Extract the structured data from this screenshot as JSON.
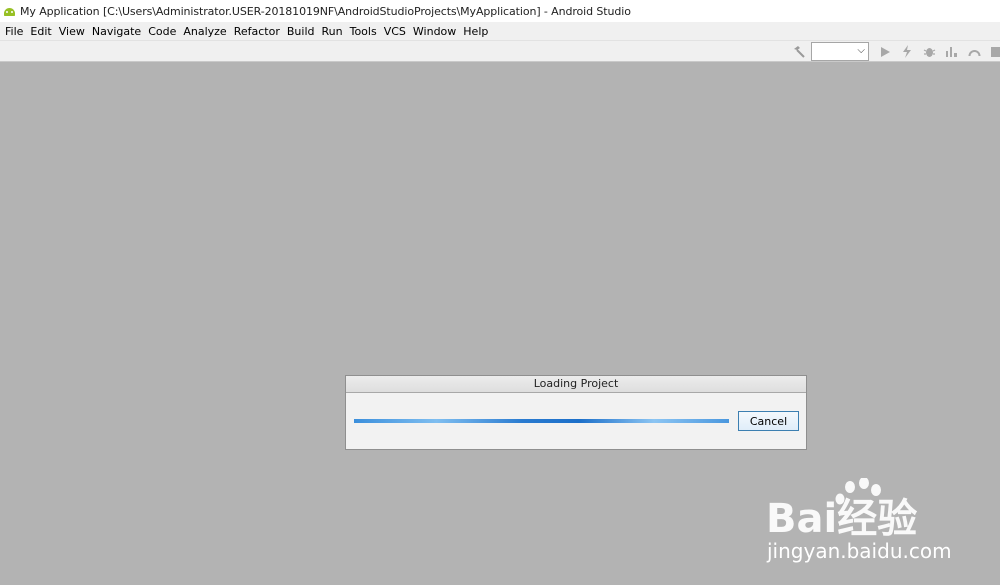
{
  "window": {
    "title": "My Application [C:\\Users\\Administrator.USER-20181019NF\\AndroidStudioProjects\\MyApplication] - Android Studio"
  },
  "menu": {
    "items": [
      {
        "label": "File"
      },
      {
        "label": "Edit"
      },
      {
        "label": "View"
      },
      {
        "label": "Navigate"
      },
      {
        "label": "Code"
      },
      {
        "label": "Analyze"
      },
      {
        "label": "Refactor"
      },
      {
        "label": "Build"
      },
      {
        "label": "Run"
      },
      {
        "label": "Tools"
      },
      {
        "label": "VCS"
      },
      {
        "label": "Window"
      },
      {
        "label": "Help"
      }
    ]
  },
  "toolbar": {
    "run_config_value": "",
    "icons": [
      "hammer-icon",
      "run-icon",
      "apply-changes-icon",
      "debug-icon",
      "profile-icon",
      "attach-debugger-icon",
      "stop-icon"
    ]
  },
  "dialog": {
    "title": "Loading Project",
    "cancel_label": "Cancel"
  },
  "watermark": {
    "logo_text": "Bai经验",
    "site": "jingyan.baidu.com"
  },
  "colors": {
    "workspace": "#b3b3b3",
    "android_green": "#97c024",
    "progress_blue": "#1c6fc9"
  }
}
